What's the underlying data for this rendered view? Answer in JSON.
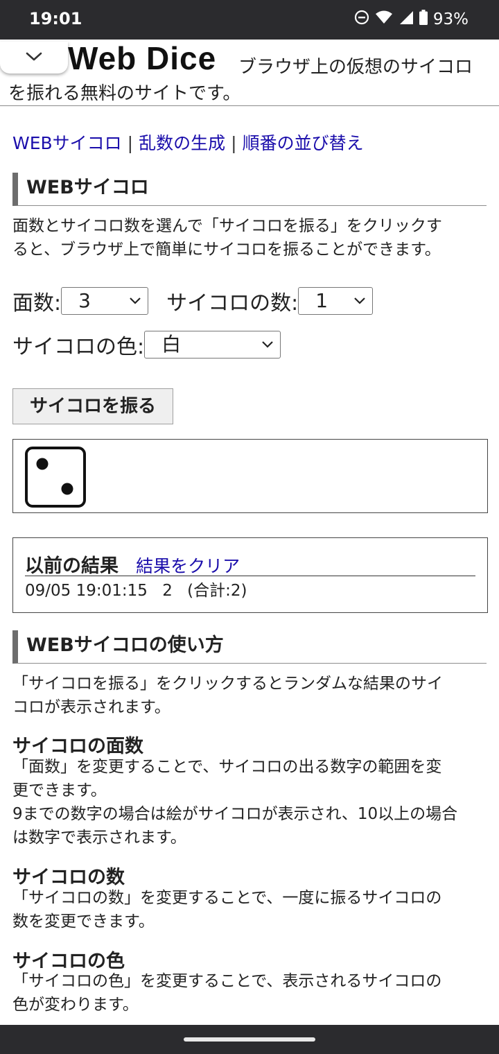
{
  "status_bar": {
    "time": "19:01",
    "battery": "93%"
  },
  "header": {
    "logo": "Web Dice",
    "tagline_line1": "ブラウザ上の仮想のサイコロ",
    "tagline_line2": "を振れる無料のサイトです。"
  },
  "nav": {
    "links": [
      "WEBサイコロ",
      "乱数の生成",
      "順番の並び替え"
    ],
    "separator": "|"
  },
  "section_dice": {
    "heading": "WEBサイコロ",
    "description_line1": "面数とサイコロ数を選んで「サイコロを振る」をクリックす",
    "description_line2": "ると、ブラウザ上で簡単にサイコロを振ることができます。"
  },
  "controls": {
    "faces_label": "面数:",
    "faces_value": "3",
    "count_label": "サイコロの数:",
    "count_value": "1",
    "color_label": "サイコロの色:",
    "color_value": "白"
  },
  "roll_button": "サイコロを振る",
  "result": {
    "die_value": 2
  },
  "history": {
    "title": "以前の結果",
    "clear_link": "結果をクリア",
    "entries": [
      {
        "datetime": "09/05 19:01:15",
        "value": "2",
        "total": "(合計:2)"
      }
    ]
  },
  "howto": {
    "heading": "WEBサイコロの使い方",
    "intro_line1": "「サイコロを振る」をクリックするとランダムな結果のサイ",
    "intro_line2": "コロが表示されます。",
    "faces_title": "サイコロの面数",
    "faces_line1": "「面数」を変更することで、サイコロの出る数字の範囲を変",
    "faces_line2": "更できます。",
    "faces_line3": "9までの数字の場合は絵がサイコロが表示され、10以上の場合",
    "faces_line4": "は数字で表示されます。",
    "count_title": "サイコロの数",
    "count_line1": "「サイコロの数」を変更することで、一度に振るサイコロの",
    "count_line2": "数を変更できます。",
    "color_title": "サイコロの色",
    "color_line1": "「サイコロの色」を変更することで、表示されるサイコロの",
    "color_line2": "色が変わります。"
  }
}
